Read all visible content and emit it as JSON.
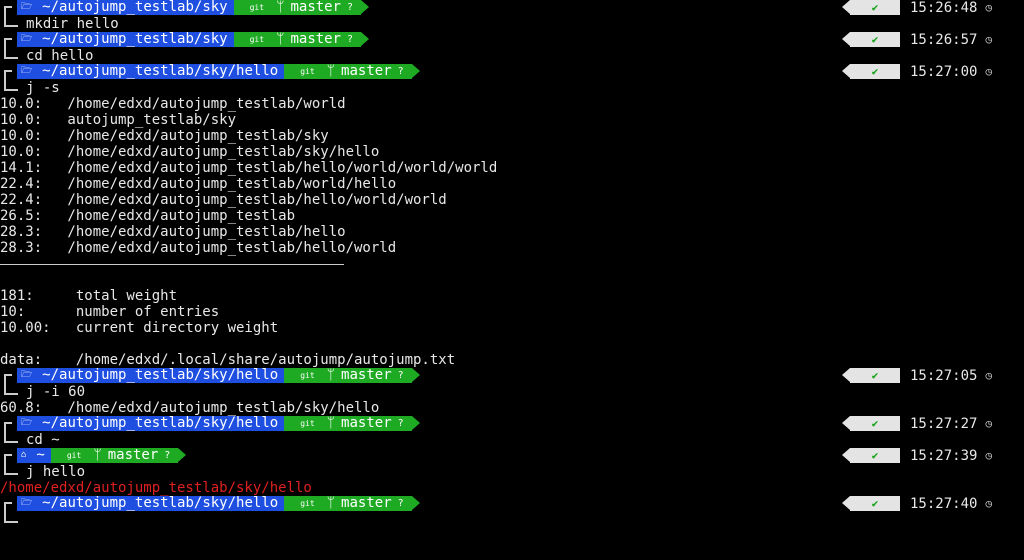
{
  "prompts": [
    {
      "dir": "~/autojump_testlab/sky",
      "git": "git",
      "branch": "master",
      "cmd": "mkdir hello",
      "time": "15:26:48"
    },
    {
      "dir": "~/autojump_testlab/sky",
      "git": "git",
      "branch": "master",
      "cmd": "cd hello",
      "time": "15:26:57"
    },
    {
      "dir": "~/autojump_testlab/sky/hello",
      "git": "git",
      "branch": "master",
      "cmd": "j -s",
      "time": "15:27:00"
    },
    {
      "dir": "~/autojump_testlab/sky/hello",
      "git": "git",
      "branch": "master",
      "cmd": "j -i 60",
      "time": "15:27:05"
    },
    {
      "dir": "~/autojump_testlab/sky/hello",
      "git": "git",
      "branch": "master",
      "cmd": "cd ~",
      "time": "15:27:27"
    },
    {
      "dir": "~",
      "git": "git",
      "branch": "master",
      "cmd": "j hello",
      "time": "15:27:39"
    },
    {
      "dir": "~/autojump_testlab/sky/hello",
      "git": "git",
      "branch": "master",
      "cmd": "",
      "time": "15:27:40"
    }
  ],
  "jstat_rows": [
    "10.0:   /home/edxd/autojump_testlab/world",
    "10.0:   autojump_testlab/sky",
    "10.0:   /home/edxd/autojump_testlab/sky",
    "10.0:   /home/edxd/autojump_testlab/sky/hello",
    "14.1:   /home/edxd/autojump_testlab/hello/world/world/world",
    "22.4:   /home/edxd/autojump_testlab/world/hello",
    "22.4:   /home/edxd/autojump_testlab/hello/world/world",
    "26.5:   /home/edxd/autojump_testlab",
    "28.3:   /home/edxd/autojump_testlab/hello",
    "28.3:   /home/edxd/autojump_testlab/hello/world"
  ],
  "stats": [
    "181:     total weight",
    "10:      number of entries",
    "10.00:   current directory weight"
  ],
  "data_line": "data:    /home/edxd/.local/share/autojump/autojump.txt",
  "increase_out": "60.8:   /home/edxd/autojump_testlab/sky/hello",
  "jump_out": "/home/edxd/autojump_testlab/sky/hello",
  "icons": {
    "dir": "folder-icon",
    "home": "home-icon",
    "branch": "branch-icon",
    "status": "check-icon",
    "clock": "clock-icon"
  }
}
